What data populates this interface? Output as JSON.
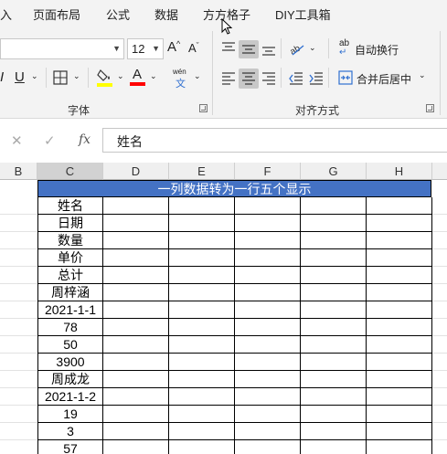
{
  "menu": {
    "items": [
      "入",
      "页面布局",
      "公式",
      "数据",
      "方方格子",
      "DIY工具箱"
    ]
  },
  "ribbon": {
    "font_size": "12",
    "underline_label": "U",
    "bold_partial": "I",
    "increase_font": "A",
    "decrease_font": "A",
    "wen_top": "wén",
    "wen_bottom": "文",
    "wrap_text_prefix": "ab",
    "wrap_text_label": "自动换行",
    "merge_center_label": "合并后居中",
    "font_group_label": "字体",
    "alignment_group_label": "对齐方式",
    "fill_color": "#ffff00",
    "font_color": "#ff0000"
  },
  "formula_bar": {
    "cancel_icon": "cancel-icon",
    "enter_icon": "check-icon",
    "fx_label": "fx",
    "value": "姓名"
  },
  "sheet": {
    "columns": [
      "B",
      "C",
      "D",
      "E",
      "F",
      "G",
      "H"
    ],
    "banner": "一列数据转为一行五个显示",
    "header_color": "#4472c4",
    "column_c_values": [
      "姓名",
      "日期",
      "数量",
      "单价",
      "总计",
      "周梓涵",
      "2021-1-1",
      "78",
      "50",
      "3900",
      "周成龙",
      "2021-1-2",
      "19",
      "3",
      "57"
    ]
  }
}
